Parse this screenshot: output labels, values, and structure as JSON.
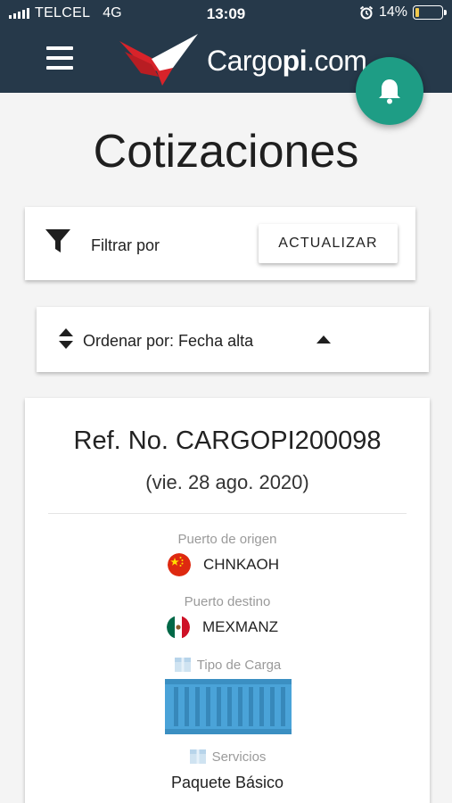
{
  "status_bar": {
    "carrier": "TELCEL",
    "network": "4G",
    "time": "13:09",
    "battery": "14%",
    "battery_level": 0.14,
    "icons": [
      "signal-icon",
      "alarm-icon",
      "battery-icon"
    ]
  },
  "app_bar": {
    "logo_prefix": "Cargo",
    "logo_bold": "pi",
    "logo_suffix": ".com",
    "brand_colors": {
      "bar": "#26394a",
      "logo_red": "#d8232a",
      "fab": "#1e9d85"
    }
  },
  "page": {
    "title": "Cotizaciones"
  },
  "filter": {
    "label": "Filtrar por",
    "refresh_button": "ACTUALIZAR"
  },
  "sort": {
    "label": "Ordenar por: Fecha alta"
  },
  "quote": {
    "ref": "Ref. No. CARGOPI200098",
    "date": "(vie. 28 ago. 2020)",
    "origin_label": "Puerto de origen",
    "origin_port": "CHNKAOH",
    "destination_label": "Puerto destino",
    "destination_port": "MEXMANZ",
    "cargo_type_label": "Tipo de Carga",
    "services_label": "Servicios",
    "services_value": "Paquete Básico"
  }
}
